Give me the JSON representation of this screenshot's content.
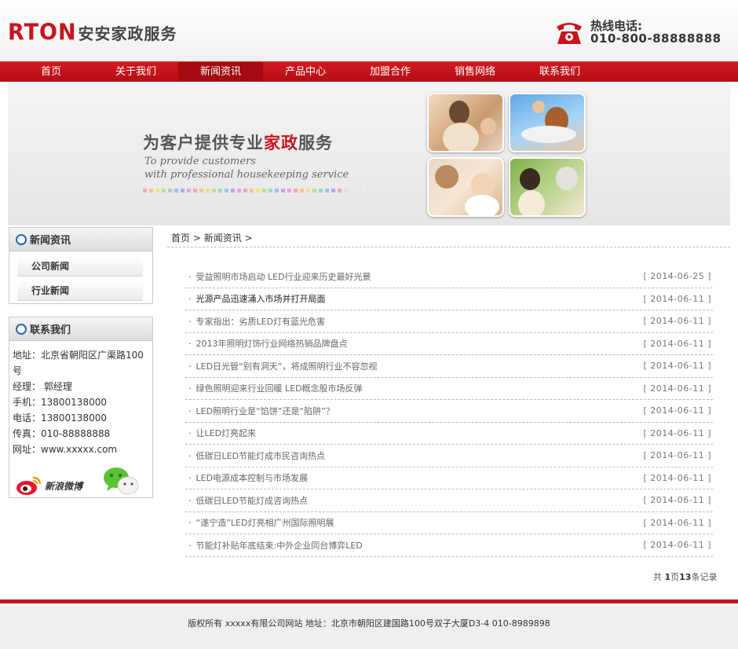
{
  "header": {
    "logo_mark": "RTON",
    "logo_name": "安安家政服务",
    "hotline_label": "热线电话:",
    "hotline_number": "010-800-88888888"
  },
  "nav": {
    "items": [
      "首页",
      "关于我们",
      "新闻资讯",
      "产品中心",
      "加盟合作",
      "销售网络",
      "联系我们"
    ],
    "active": "新闻资讯"
  },
  "banner": {
    "title_a": "为客户提供专业",
    "title_hl": "家政",
    "title_b": "服务",
    "en_line1": "To provide customers",
    "en_line2": "with professional housekeeping service"
  },
  "sidebar": {
    "news_title": "新闻资讯",
    "news_menu": [
      "公司新闻",
      "行业新闻"
    ],
    "contact_title": "联系我们",
    "contact_lines": [
      "地址：北京省朝阳区广渠路100号",
      "经理： 郭经理",
      "手机：13800138000",
      "电话：13800138000",
      "传真：010-88888888",
      "网址：www.xxxxx.com"
    ],
    "weibo_label": "新浪微博"
  },
  "breadcrumb": {
    "home": "首页",
    "sep": ">",
    "current": "新闻资讯",
    "sep2": ">"
  },
  "news": [
    {
      "title": "受益照明市场启动 LED行业迎来历史最好光景",
      "date": "[ 2014-06-25 ]"
    },
    {
      "title": "光源产品迅速涌入市场并打开局面",
      "date": "[ 2014-06-11 ]"
    },
    {
      "title": "专家指出：劣质LED灯有蓝光危害",
      "date": "[ 2014-06-11 ]"
    },
    {
      "title": "2013年照明灯饰行业网络热销品牌盘点",
      "date": "[ 2014-06-11 ]"
    },
    {
      "title": "LED日光管“别有洞天”，将成照明行业不容忽视",
      "date": "[ 2014-06-11 ]"
    },
    {
      "title": "绿色照明迎来行业回暖 LED概念股市场反弹",
      "date": "[ 2014-06-11 ]"
    },
    {
      "title": "LED照明行业是“馅饼”还是“陷阱”？",
      "date": "[ 2014-06-11 ]"
    },
    {
      "title": "让LED灯亮起来",
      "date": "[ 2014-06-11 ]"
    },
    {
      "title": "低碳日LED节能灯成市民咨询热点",
      "date": "[ 2014-06-11 ]"
    },
    {
      "title": "LED电源成本控制与市场发展",
      "date": "[ 2014-06-11 ]"
    },
    {
      "title": "低碳日LED节能灯成咨询热点",
      "date": "[ 2014-06-11 ]"
    },
    {
      "title": "“遂宁造”LED灯亮相广州国际照明展",
      "date": "[ 2014-06-11 ]"
    },
    {
      "title": "节能灯补贴年底结束:中外企业同台博弈LED",
      "date": "[ 2014-06-11 ]"
    }
  ],
  "pager": {
    "prefix": "共",
    "pages": "1",
    "pages_unit": "页",
    "count": "13",
    "count_unit": "条记录"
  },
  "footer": {
    "text": "版权所有 xxxxx有限公司网站 地址：北京市朝阳区建国路100号双子大厦D3-4 010-8989898"
  },
  "colors": {
    "brand_red": "#c8141c",
    "nav_active": "#a40b11",
    "icon_blue": "#2a64b8"
  }
}
